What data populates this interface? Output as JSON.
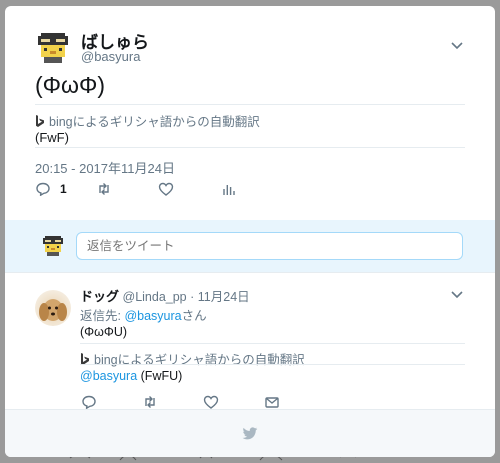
{
  "tweet": {
    "display_name": "ばしゅら",
    "screen_name": "@basyura",
    "text": "(ΦωΦ)",
    "translate_label": "bingによるギリシャ語からの自動翻訳",
    "translation": "(FwF)",
    "timestamp": "20:15 - 2017年11月24日",
    "reply_count": "1"
  },
  "reply_box": {
    "placeholder": "返信をツイート"
  },
  "reply": {
    "display_name": "ドッグ",
    "screen_name": "@Linda_pp",
    "date": "· 11月24日",
    "reply_to_prefix": "返信先: ",
    "reply_to_handle": "@basyura",
    "reply_to_suffix": "さん",
    "text": "(ΦωΦU)",
    "translate_label": "bingによるギリシャ語からの自動翻訳",
    "translation_mention": "@basyura",
    "translation_text": " (FwFU)"
  },
  "icons": [
    "bing-icon",
    "reply-icon",
    "retweet-icon",
    "like-icon",
    "analytics-icon",
    "dm-icon",
    "chevron-down-icon",
    "twitter-bird-icon"
  ],
  "colors": {
    "accent": "#1b95e0",
    "muted": "#657786",
    "text": "#14171a",
    "reply_bg": "#e8f5fd"
  }
}
